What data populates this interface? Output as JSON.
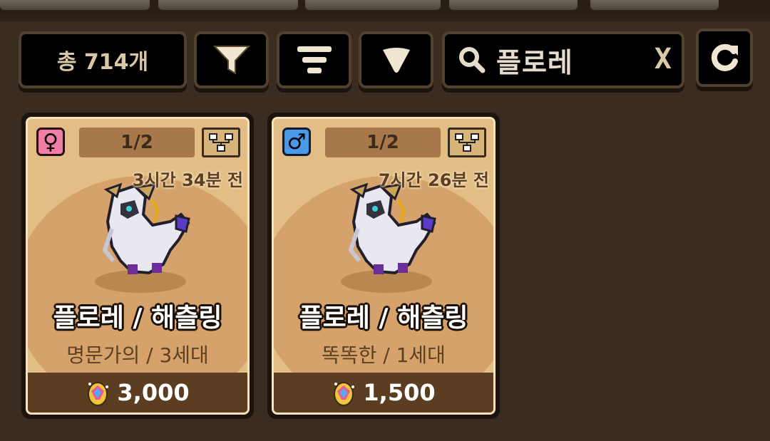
{
  "toolbar": {
    "count_label": "총 714개",
    "search_value": "플로레",
    "clear_label": "X",
    "filter_icon": "filter-funnel-icon",
    "sort_icon": "sort-lines-icon",
    "dropdown_icon": "triangle-down-icon",
    "refresh_icon": "refresh-icon"
  },
  "cards": [
    {
      "gender": "♀",
      "gender_icon": "female-icon",
      "ratio": "1/2",
      "time_ago": "3시간 34분 전",
      "name": "플로레 / 해츨링",
      "subtitle": "명문가의 / 3세대",
      "price": "3,000",
      "color": "#f07fa6"
    },
    {
      "gender": "♂",
      "gender_icon": "male-icon",
      "ratio": "1/2",
      "time_ago": "7시간 26분 전",
      "name": "플로레 / 해츨링",
      "subtitle": "똑똑한 / 1세대",
      "price": "1,500",
      "color": "#4a98e8"
    }
  ]
}
